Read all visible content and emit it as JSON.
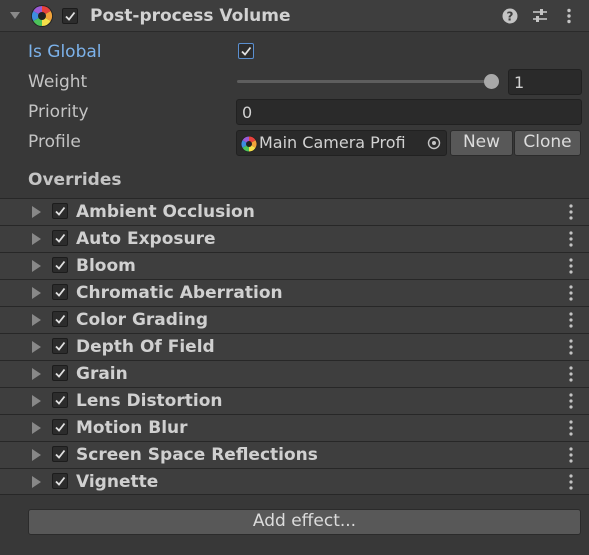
{
  "component": {
    "title": "Post-process Volume",
    "enabled": true,
    "icons": [
      "fold-arrow-icon",
      "post-process-volume-icon",
      "help-icon",
      "presets-icon",
      "kebab-menu-icon"
    ]
  },
  "properties": {
    "is_global_label": "Is Global",
    "is_global": true,
    "weight_label": "Weight",
    "weight_value": "1",
    "weight_fraction": 1,
    "priority_label": "Priority",
    "priority_value": "0",
    "profile_label": "Profile",
    "profile_value": "Main Camera Profi",
    "new_label": "New",
    "clone_label": "Clone"
  },
  "overrides": {
    "title": "Overrides",
    "items": [
      {
        "label": "Ambient Occlusion",
        "enabled": true
      },
      {
        "label": "Auto Exposure",
        "enabled": true
      },
      {
        "label": "Bloom",
        "enabled": true
      },
      {
        "label": "Chromatic Aberration",
        "enabled": true
      },
      {
        "label": "Color Grading",
        "enabled": true
      },
      {
        "label": "Depth Of Field",
        "enabled": true
      },
      {
        "label": "Grain",
        "enabled": true
      },
      {
        "label": "Lens Distortion",
        "enabled": true
      },
      {
        "label": "Motion Blur",
        "enabled": true
      },
      {
        "label": "Screen Space Reflections",
        "enabled": true
      },
      {
        "label": "Vignette",
        "enabled": true
      }
    ],
    "add_effect_label": "Add effect..."
  },
  "colors": {
    "background": "#383838",
    "header": "#3e3e3e",
    "accent_label": "#7cb2ea",
    "field": "#2a2a2a",
    "button": "#585858"
  }
}
